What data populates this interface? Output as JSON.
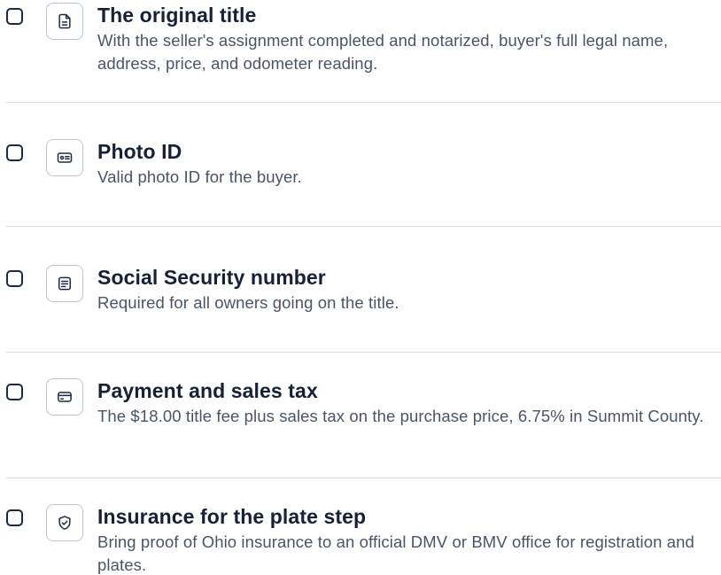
{
  "checklist": {
    "items": [
      {
        "title": "The original title",
        "description": "With the seller's assignment completed and notarized, buyer's full legal name, address, price, and odometer reading.",
        "icon": "document-icon",
        "checked": false
      },
      {
        "title": "Photo ID",
        "description": "Valid photo ID for the buyer.",
        "icon": "id-card-icon",
        "checked": false
      },
      {
        "title": "Social Security number",
        "description": "Required for all owners going on the title.",
        "icon": "list-document-icon",
        "checked": false
      },
      {
        "title": "Payment and sales tax",
        "description": "The $18.00 title fee plus sales tax on the purchase price, 6.75% in Summit County.",
        "icon": "credit-card-icon",
        "checked": false
      },
      {
        "title": "Insurance for the plate step",
        "description": "Bring proof of Ohio insurance to an official DMV or BMV office for registration and plates.",
        "icon": "shield-check-icon",
        "checked": false
      }
    ]
  },
  "colors": {
    "checkbox_border": "#1a2a44",
    "icon_box_border": "#b8c7d6",
    "icon_stroke": "#1d2c45",
    "title": "#142136",
    "description": "#4a5568",
    "divider": "#d8dee6"
  }
}
